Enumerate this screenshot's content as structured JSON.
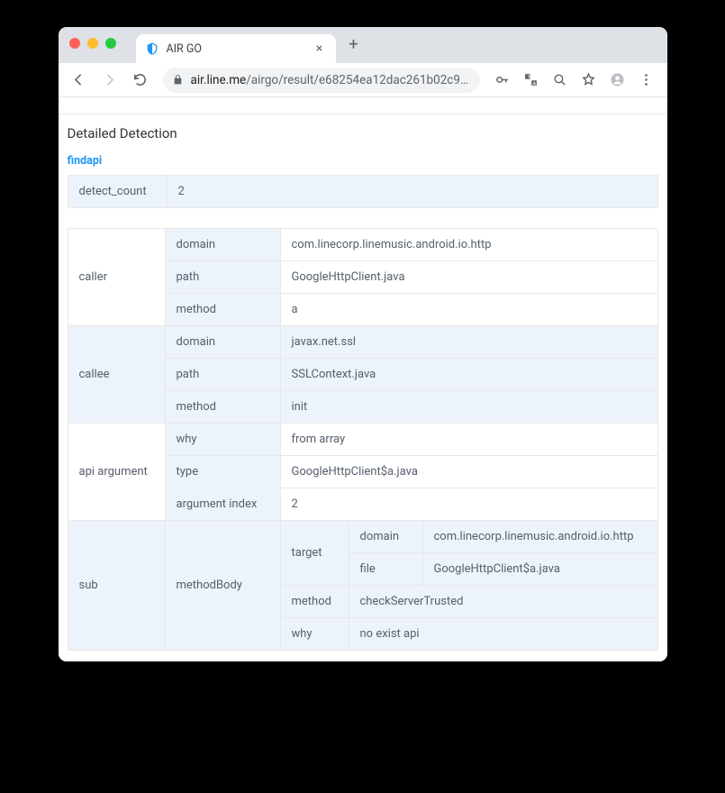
{
  "tab": {
    "title": "AIR GO"
  },
  "url": {
    "host": "air.line.me",
    "path": "/airgo/result/e68254ea12dac261b02c9…"
  },
  "page": {
    "heading": "Detailed Detection",
    "link": "findapi",
    "detect_count_label": "detect_count",
    "detect_count_value": "2"
  },
  "caller": {
    "label": "caller",
    "rows": {
      "domain": {
        "k": "domain",
        "v": "com.linecorp.linemusic.android.io.http"
      },
      "path": {
        "k": "path",
        "v": "GoogleHttpClient.java"
      },
      "method": {
        "k": "method",
        "v": "a"
      }
    }
  },
  "callee": {
    "label": "callee",
    "rows": {
      "domain": {
        "k": "domain",
        "v": "javax.net.ssl"
      },
      "path": {
        "k": "path",
        "v": "SSLContext.java"
      },
      "method": {
        "k": "method",
        "v": "init"
      }
    }
  },
  "api_argument": {
    "label": "api argument",
    "rows": {
      "why": {
        "k": "why",
        "v": "from array"
      },
      "type": {
        "k": "type",
        "v": "GoogleHttpClient$a.java"
      },
      "argument_index": {
        "k": "argument index",
        "v": "2"
      }
    }
  },
  "sub": {
    "label": "sub",
    "methodBody_label": "methodBody",
    "target": {
      "label": "target",
      "domain": {
        "k": "domain",
        "v": "com.linecorp.linemusic.android.io.http"
      },
      "file": {
        "k": "file",
        "v": "GoogleHttpClient$a.java"
      }
    },
    "method": {
      "k": "method",
      "v": "checkServerTrusted"
    },
    "why": {
      "k": "why",
      "v": "no exist api"
    }
  }
}
